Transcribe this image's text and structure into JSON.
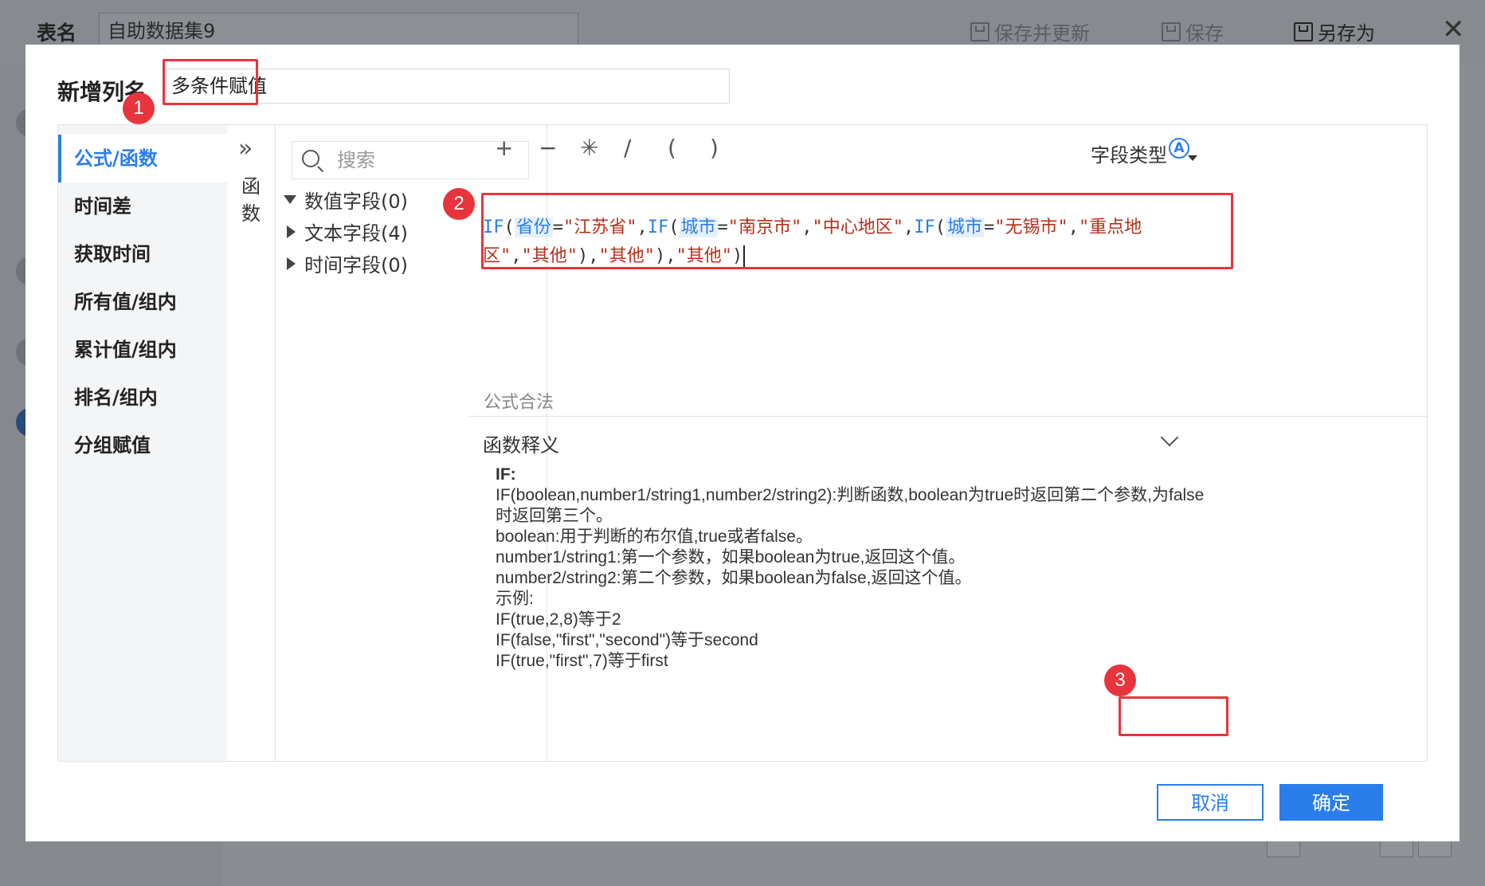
{
  "topbar": {
    "name_label": "表名",
    "name_value": "自助数据集9",
    "save_update_label": "保存并更新",
    "save_label": "保存",
    "save_as_label": "另存为",
    "close_icon": "close-icon"
  },
  "dialog": {
    "title": "新增列名",
    "column_name": "多条件赋值",
    "categories": [
      "公式/函数",
      "时间差",
      "获取时间",
      "所有值/组内",
      "累计值/组内",
      "排名/组内",
      "分组赋值"
    ],
    "collapse_label": "函数",
    "search_placeholder": "搜索",
    "field_groups": [
      "数值字段(0)",
      "文本字段(4)",
      "时间字段(0)"
    ],
    "operators": [
      "+",
      "−",
      "✳",
      "/",
      "(",
      ")"
    ],
    "field_type_label": "字段类型",
    "field_type_icon": "A",
    "formula_valid": "公式合法",
    "definition_title": "函数释义",
    "definition_lines": [
      "IF:",
      "IF(boolean,number1/string1,number2/string2):判断函数,boolean为true时返回第二个参数,为false时返回第三个。",
      "boolean:用于判断的布尔值,true或者false。",
      "number1/string1:第一个参数，如果boolean为true,返回这个值。",
      "number2/string2:第二个参数，如果boolean为false,返回这个值。",
      "示例:",
      "IF(true,2,8)等于2",
      "IF(false,\"first\",\"second\")等于second",
      "IF(true,\"first\",7)等于first"
    ],
    "cancel_label": "取消",
    "ok_label": "确定",
    "badges": [
      "1",
      "2",
      "3"
    ]
  },
  "formula": {
    "tokens": [
      {
        "t": "fn",
        "v": "IF"
      },
      {
        "t": "p",
        "v": "("
      },
      {
        "t": "field",
        "v": "省份"
      },
      {
        "t": "p",
        "v": "="
      },
      {
        "t": "str",
        "v": "\"江苏省\""
      },
      {
        "t": "p",
        "v": ","
      },
      {
        "t": "fn",
        "v": "IF"
      },
      {
        "t": "p",
        "v": "("
      },
      {
        "t": "field",
        "v": "城市"
      },
      {
        "t": "p",
        "v": "="
      },
      {
        "t": "str",
        "v": "\"南京市\""
      },
      {
        "t": "p",
        "v": ","
      },
      {
        "t": "str",
        "v": "\"中心地区\""
      },
      {
        "t": "p",
        "v": ","
      },
      {
        "t": "fn",
        "v": "IF"
      },
      {
        "t": "p",
        "v": "("
      },
      {
        "t": "field",
        "v": "城市"
      },
      {
        "t": "p",
        "v": "="
      },
      {
        "t": "str",
        "v": "\"无锡市\""
      },
      {
        "t": "p",
        "v": ","
      },
      {
        "t": "str",
        "v": "\"重点地区\""
      },
      {
        "t": "p",
        "v": ","
      },
      {
        "t": "str",
        "v": "\"其他\""
      },
      {
        "t": "p",
        "v": "),"
      },
      {
        "t": "str",
        "v": "\"其他\""
      },
      {
        "t": "p",
        "v": "),"
      },
      {
        "t": "str",
        "v": "\"其他\""
      },
      {
        "t": "p",
        "v": ")"
      }
    ]
  },
  "colors": {
    "accent": "#2b7de9",
    "highlight": "#e8343c",
    "string": "#b5301b"
  }
}
